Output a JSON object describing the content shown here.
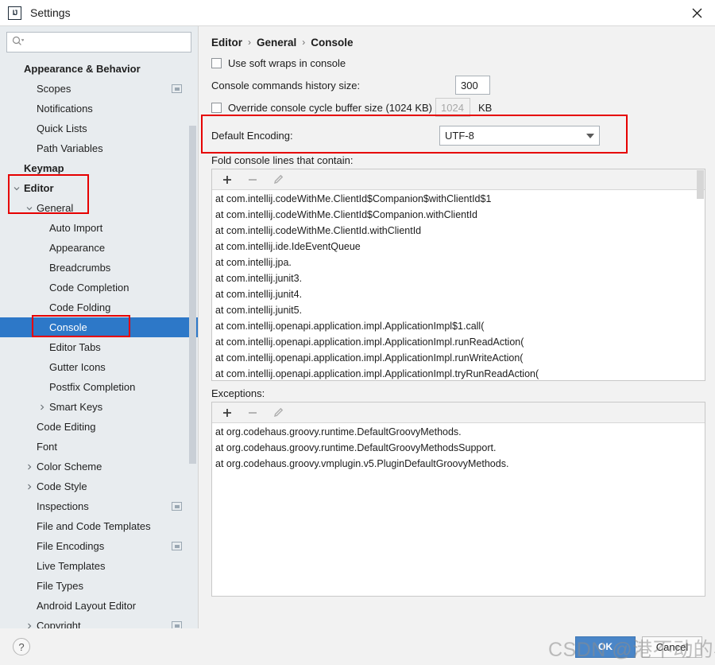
{
  "window": {
    "title": "Settings",
    "logo_text": "IJ",
    "close_icon": "close-icon"
  },
  "sidebar": {
    "search": {
      "value": "",
      "placeholder": ""
    },
    "items": [
      {
        "label": "Appearance & Behavior",
        "indent": 0,
        "bold": true,
        "arrow": "",
        "badge": false,
        "selected": false
      },
      {
        "label": "Scopes",
        "indent": 1,
        "bold": false,
        "arrow": "",
        "badge": true,
        "selected": false
      },
      {
        "label": "Notifications",
        "indent": 1,
        "bold": false,
        "arrow": "",
        "badge": false,
        "selected": false
      },
      {
        "label": "Quick Lists",
        "indent": 1,
        "bold": false,
        "arrow": "",
        "badge": false,
        "selected": false
      },
      {
        "label": "Path Variables",
        "indent": 1,
        "bold": false,
        "arrow": "",
        "badge": false,
        "selected": false
      },
      {
        "label": "Keymap",
        "indent": 0,
        "bold": true,
        "arrow": "",
        "badge": false,
        "selected": false
      },
      {
        "label": "Editor",
        "indent": 0,
        "bold": true,
        "arrow": "down",
        "badge": false,
        "selected": false
      },
      {
        "label": "General",
        "indent": 1,
        "bold": false,
        "arrow": "down",
        "badge": false,
        "selected": false
      },
      {
        "label": "Auto Import",
        "indent": 2,
        "bold": false,
        "arrow": "",
        "badge": false,
        "selected": false
      },
      {
        "label": "Appearance",
        "indent": 2,
        "bold": false,
        "arrow": "",
        "badge": false,
        "selected": false
      },
      {
        "label": "Breadcrumbs",
        "indent": 2,
        "bold": false,
        "arrow": "",
        "badge": false,
        "selected": false
      },
      {
        "label": "Code Completion",
        "indent": 2,
        "bold": false,
        "arrow": "",
        "badge": false,
        "selected": false
      },
      {
        "label": "Code Folding",
        "indent": 2,
        "bold": false,
        "arrow": "",
        "badge": false,
        "selected": false
      },
      {
        "label": "Console",
        "indent": 2,
        "bold": false,
        "arrow": "",
        "badge": false,
        "selected": true
      },
      {
        "label": "Editor Tabs",
        "indent": 2,
        "bold": false,
        "arrow": "",
        "badge": false,
        "selected": false
      },
      {
        "label": "Gutter Icons",
        "indent": 2,
        "bold": false,
        "arrow": "",
        "badge": false,
        "selected": false
      },
      {
        "label": "Postfix Completion",
        "indent": 2,
        "bold": false,
        "arrow": "",
        "badge": false,
        "selected": false
      },
      {
        "label": "Smart Keys",
        "indent": 2,
        "bold": false,
        "arrow": "right",
        "badge": false,
        "selected": false
      },
      {
        "label": "Code Editing",
        "indent": 1,
        "bold": false,
        "arrow": "",
        "badge": false,
        "selected": false
      },
      {
        "label": "Font",
        "indent": 1,
        "bold": false,
        "arrow": "",
        "badge": false,
        "selected": false
      },
      {
        "label": "Color Scheme",
        "indent": 1,
        "bold": false,
        "arrow": "right",
        "badge": false,
        "selected": false
      },
      {
        "label": "Code Style",
        "indent": 1,
        "bold": false,
        "arrow": "right",
        "badge": false,
        "selected": false
      },
      {
        "label": "Inspections",
        "indent": 1,
        "bold": false,
        "arrow": "",
        "badge": true,
        "selected": false
      },
      {
        "label": "File and Code Templates",
        "indent": 1,
        "bold": false,
        "arrow": "",
        "badge": false,
        "selected": false
      },
      {
        "label": "File Encodings",
        "indent": 1,
        "bold": false,
        "arrow": "",
        "badge": true,
        "selected": false
      },
      {
        "label": "Live Templates",
        "indent": 1,
        "bold": false,
        "arrow": "",
        "badge": false,
        "selected": false
      },
      {
        "label": "File Types",
        "indent": 1,
        "bold": false,
        "arrow": "",
        "badge": false,
        "selected": false
      },
      {
        "label": "Android Layout Editor",
        "indent": 1,
        "bold": false,
        "arrow": "",
        "badge": false,
        "selected": false
      },
      {
        "label": "Copyright",
        "indent": 1,
        "bold": false,
        "arrow": "right",
        "badge": true,
        "selected": false
      }
    ]
  },
  "main": {
    "breadcrumb": [
      "Editor",
      "General",
      "Console"
    ],
    "breadcrumb_separator": "›",
    "soft_wraps_label": "Use soft wraps in console",
    "soft_wraps_checked": false,
    "history_label": "Console commands history size:",
    "history_value": "300",
    "override_label": "Override console cycle buffer size (1024 KB)",
    "override_checked": false,
    "buffer_value": "1024",
    "kb_label": "KB",
    "encoding_label": "Default Encoding:",
    "encoding_value": "UTF-8",
    "fold_label": "Fold console lines that contain:",
    "exceptions_label": "Exceptions:",
    "toolbar": {
      "add": "+",
      "remove": "−",
      "edit": "edit-pencil-icon"
    },
    "fold_items": [
      "at com.intellij.codeWithMe.ClientId$Companion$withClientId$1",
      "at com.intellij.codeWithMe.ClientId$Companion.withClientId",
      "at com.intellij.codeWithMe.ClientId.withClientId",
      "at com.intellij.ide.IdeEventQueue",
      "at com.intellij.jpa.",
      "at com.intellij.junit3.",
      "at com.intellij.junit4.",
      "at com.intellij.junit5.",
      "at com.intellij.openapi.application.impl.ApplicationImpl$1.call(",
      "at com.intellij.openapi.application.impl.ApplicationImpl.runReadAction(",
      "at com.intellij.openapi.application.impl.ApplicationImpl.runWriteAction(",
      "at com.intellij.openapi.application.impl.ApplicationImpl.tryRunReadAction("
    ],
    "exception_items": [
      "at org.codehaus.groovy.runtime.DefaultGroovyMethods.",
      "at org.codehaus.groovy.runtime.DefaultGroovyMethodsSupport.",
      "at org.codehaus.groovy.vmplugin.v5.PluginDefaultGroovyMethods."
    ]
  },
  "footer": {
    "help": "?",
    "ok": "OK",
    "cancel": "Cancel"
  },
  "watermark": "CSDN @港不动的小白",
  "colors": {
    "selection": "#2d78c8",
    "annotation": "#e60000",
    "primary_button": "#4a86c8",
    "sidebar_bg": "#e8ecef",
    "panel_bg": "#f2f2f2"
  }
}
